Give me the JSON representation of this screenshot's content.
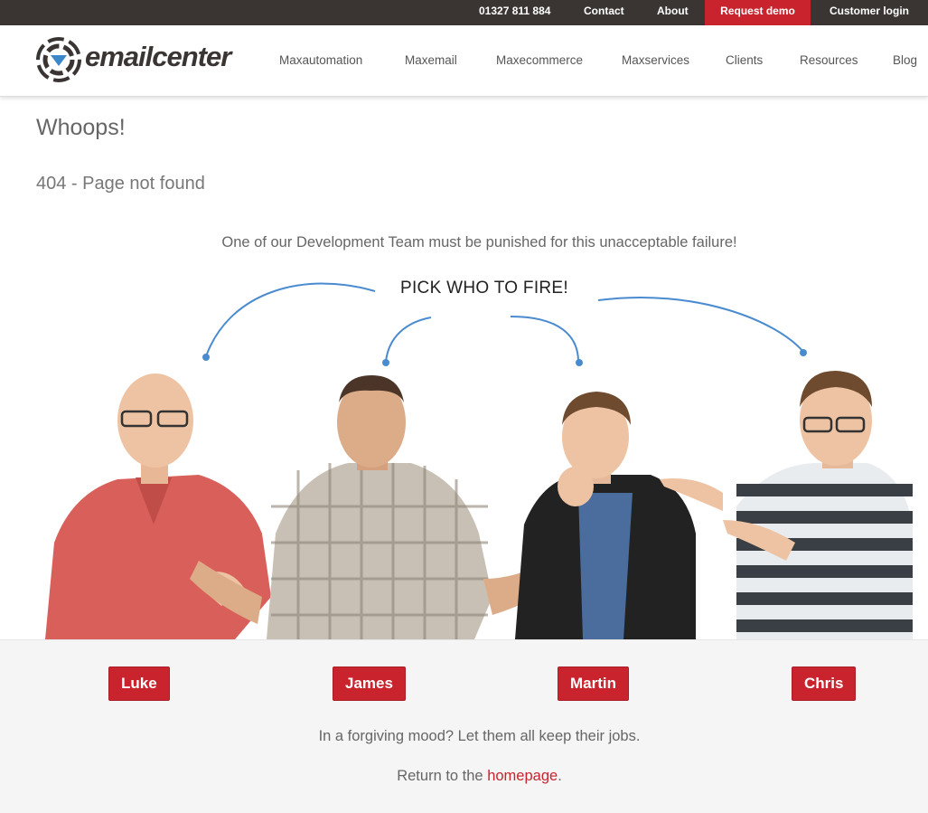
{
  "topbar": {
    "phone": "01327 811 884",
    "contact": "Contact",
    "about": "About",
    "request_demo": "Request demo",
    "customer_login": "Customer login"
  },
  "header": {
    "logo_text": "emailcenter",
    "nav": [
      "Maxautomation",
      "Maxemail",
      "Maxecommerce",
      "Maxservices",
      "Clients",
      "Resources",
      "Blog"
    ]
  },
  "main": {
    "title": "Whoops!",
    "subtitle": "404 - Page not found",
    "intro": "One of our Development Team must be punished for this unacceptable failure!",
    "pick_prompt": "PICK WHO TO FIRE!",
    "team": [
      "Luke",
      "James",
      "Martin",
      "Chris"
    ],
    "forgive_text": "In a forgiving mood? Let them all keep their jobs.",
    "return_prefix": "Return to the ",
    "return_link": "homepage",
    "return_suffix": "."
  },
  "colors": {
    "topbar_bg": "#3a3533",
    "brand_red": "#c9242d",
    "arrow_blue": "#4a8bd0",
    "logo_blue": "#3b88c8"
  }
}
